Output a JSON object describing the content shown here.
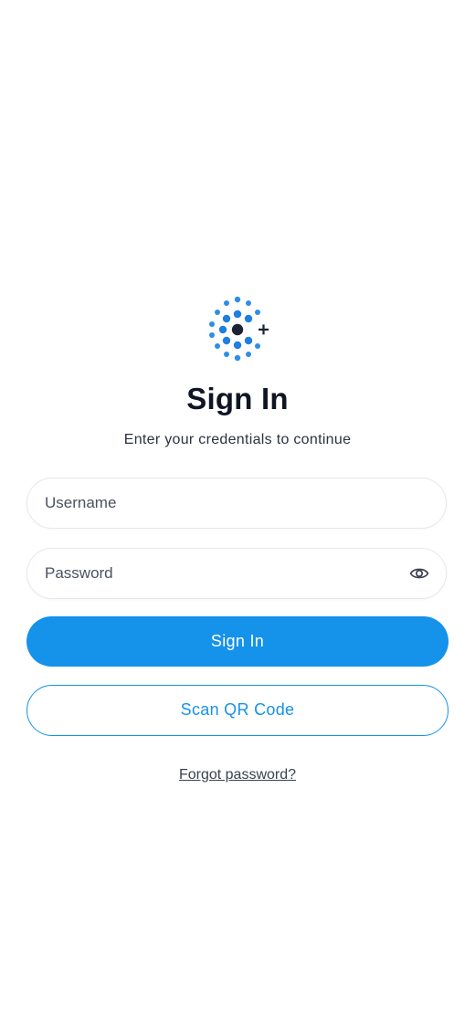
{
  "header": {
    "logo_icon": "dotted-circle-plus-icon",
    "title": "Sign In",
    "subtitle": "Enter your credentials to continue"
  },
  "form": {
    "username_placeholder": "Username",
    "username_value": "",
    "password_placeholder": "Password",
    "password_value": "",
    "password_toggle_icon": "eye-icon"
  },
  "actions": {
    "sign_in_label": "Sign In",
    "scan_qr_label": "Scan QR Code",
    "forgot_label": "Forgot password?"
  },
  "colors": {
    "accent": "#1592ea",
    "text_dark": "#0f1524",
    "logo_dark": "#1a2233"
  }
}
